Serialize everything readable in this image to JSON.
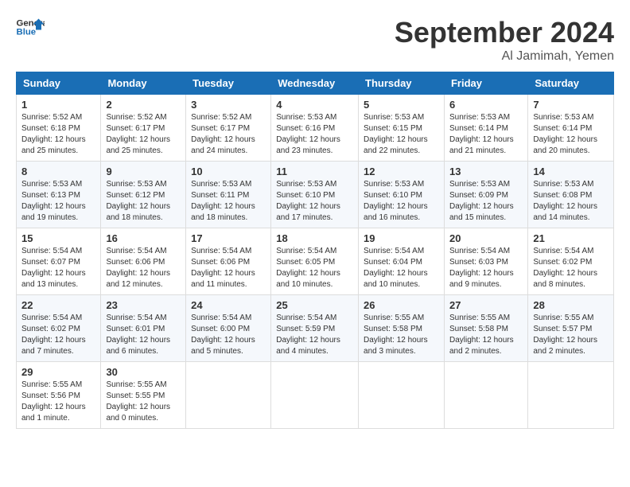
{
  "header": {
    "logo_line1": "General",
    "logo_line2": "Blue",
    "month_title": "September 2024",
    "location": "Al Jamimah, Yemen"
  },
  "columns": [
    "Sunday",
    "Monday",
    "Tuesday",
    "Wednesday",
    "Thursday",
    "Friday",
    "Saturday"
  ],
  "weeks": [
    [
      {
        "day": "1",
        "info": "Sunrise: 5:52 AM\nSunset: 6:18 PM\nDaylight: 12 hours and 25 minutes."
      },
      {
        "day": "2",
        "info": "Sunrise: 5:52 AM\nSunset: 6:17 PM\nDaylight: 12 hours and 25 minutes."
      },
      {
        "day": "3",
        "info": "Sunrise: 5:52 AM\nSunset: 6:17 PM\nDaylight: 12 hours and 24 minutes."
      },
      {
        "day": "4",
        "info": "Sunrise: 5:53 AM\nSunset: 6:16 PM\nDaylight: 12 hours and 23 minutes."
      },
      {
        "day": "5",
        "info": "Sunrise: 5:53 AM\nSunset: 6:15 PM\nDaylight: 12 hours and 22 minutes."
      },
      {
        "day": "6",
        "info": "Sunrise: 5:53 AM\nSunset: 6:14 PM\nDaylight: 12 hours and 21 minutes."
      },
      {
        "day": "7",
        "info": "Sunrise: 5:53 AM\nSunset: 6:14 PM\nDaylight: 12 hours and 20 minutes."
      }
    ],
    [
      {
        "day": "8",
        "info": "Sunrise: 5:53 AM\nSunset: 6:13 PM\nDaylight: 12 hours and 19 minutes."
      },
      {
        "day": "9",
        "info": "Sunrise: 5:53 AM\nSunset: 6:12 PM\nDaylight: 12 hours and 18 minutes."
      },
      {
        "day": "10",
        "info": "Sunrise: 5:53 AM\nSunset: 6:11 PM\nDaylight: 12 hours and 18 minutes."
      },
      {
        "day": "11",
        "info": "Sunrise: 5:53 AM\nSunset: 6:10 PM\nDaylight: 12 hours and 17 minutes."
      },
      {
        "day": "12",
        "info": "Sunrise: 5:53 AM\nSunset: 6:10 PM\nDaylight: 12 hours and 16 minutes."
      },
      {
        "day": "13",
        "info": "Sunrise: 5:53 AM\nSunset: 6:09 PM\nDaylight: 12 hours and 15 minutes."
      },
      {
        "day": "14",
        "info": "Sunrise: 5:53 AM\nSunset: 6:08 PM\nDaylight: 12 hours and 14 minutes."
      }
    ],
    [
      {
        "day": "15",
        "info": "Sunrise: 5:54 AM\nSunset: 6:07 PM\nDaylight: 12 hours and 13 minutes."
      },
      {
        "day": "16",
        "info": "Sunrise: 5:54 AM\nSunset: 6:06 PM\nDaylight: 12 hours and 12 minutes."
      },
      {
        "day": "17",
        "info": "Sunrise: 5:54 AM\nSunset: 6:06 PM\nDaylight: 12 hours and 11 minutes."
      },
      {
        "day": "18",
        "info": "Sunrise: 5:54 AM\nSunset: 6:05 PM\nDaylight: 12 hours and 10 minutes."
      },
      {
        "day": "19",
        "info": "Sunrise: 5:54 AM\nSunset: 6:04 PM\nDaylight: 12 hours and 10 minutes."
      },
      {
        "day": "20",
        "info": "Sunrise: 5:54 AM\nSunset: 6:03 PM\nDaylight: 12 hours and 9 minutes."
      },
      {
        "day": "21",
        "info": "Sunrise: 5:54 AM\nSunset: 6:02 PM\nDaylight: 12 hours and 8 minutes."
      }
    ],
    [
      {
        "day": "22",
        "info": "Sunrise: 5:54 AM\nSunset: 6:02 PM\nDaylight: 12 hours and 7 minutes."
      },
      {
        "day": "23",
        "info": "Sunrise: 5:54 AM\nSunset: 6:01 PM\nDaylight: 12 hours and 6 minutes."
      },
      {
        "day": "24",
        "info": "Sunrise: 5:54 AM\nSunset: 6:00 PM\nDaylight: 12 hours and 5 minutes."
      },
      {
        "day": "25",
        "info": "Sunrise: 5:54 AM\nSunset: 5:59 PM\nDaylight: 12 hours and 4 minutes."
      },
      {
        "day": "26",
        "info": "Sunrise: 5:55 AM\nSunset: 5:58 PM\nDaylight: 12 hours and 3 minutes."
      },
      {
        "day": "27",
        "info": "Sunrise: 5:55 AM\nSunset: 5:58 PM\nDaylight: 12 hours and 2 minutes."
      },
      {
        "day": "28",
        "info": "Sunrise: 5:55 AM\nSunset: 5:57 PM\nDaylight: 12 hours and 2 minutes."
      }
    ],
    [
      {
        "day": "29",
        "info": "Sunrise: 5:55 AM\nSunset: 5:56 PM\nDaylight: 12 hours and 1 minute."
      },
      {
        "day": "30",
        "info": "Sunrise: 5:55 AM\nSunset: 5:55 PM\nDaylight: 12 hours and 0 minutes."
      },
      {
        "day": "",
        "info": ""
      },
      {
        "day": "",
        "info": ""
      },
      {
        "day": "",
        "info": ""
      },
      {
        "day": "",
        "info": ""
      },
      {
        "day": "",
        "info": ""
      }
    ]
  ]
}
